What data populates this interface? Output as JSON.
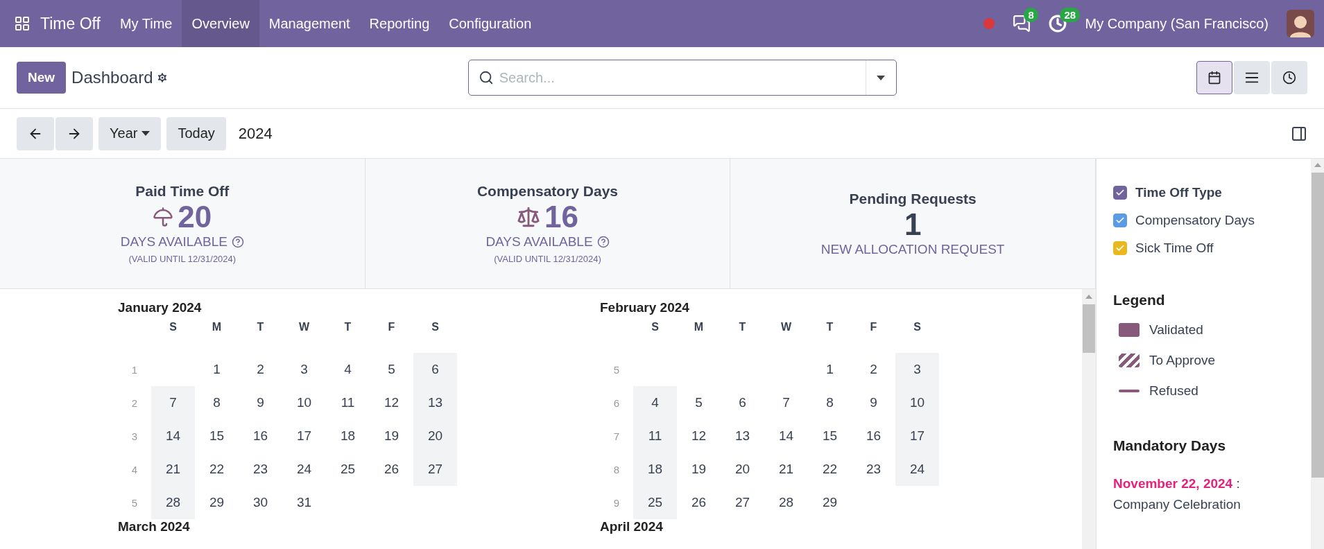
{
  "navbar": {
    "app_name": "Time Off",
    "menu": [
      {
        "label": "My Time",
        "selected": false
      },
      {
        "label": "Overview",
        "selected": true
      },
      {
        "label": "Management",
        "selected": false
      },
      {
        "label": "Reporting",
        "selected": false
      },
      {
        "label": "Configuration",
        "selected": false
      }
    ],
    "messages_count": "8",
    "activities_count": "28",
    "company": "My Company (San Francisco)"
  },
  "control_panel": {
    "new_button": "New",
    "breadcrumb": "Dashboard",
    "search": {
      "placeholder": "Search..."
    },
    "views": [
      {
        "kind": "calendar",
        "selected": true
      },
      {
        "kind": "list",
        "selected": false
      },
      {
        "kind": "activity",
        "selected": false
      }
    ]
  },
  "date_nav": {
    "scale": "Year",
    "today": "Today",
    "period": "2024"
  },
  "summary": [
    {
      "kind": "allocation",
      "title": "Paid Time Off",
      "count": "20",
      "label": "DAYS AVAILABLE",
      "validity": "(VALID UNTIL 12/31/2024)"
    },
    {
      "kind": "allocation",
      "title": "Compensatory Days",
      "count": "16",
      "label": "DAYS AVAILABLE",
      "validity": "(VALID UNTIL 12/31/2024)"
    },
    {
      "kind": "pending",
      "title": "Pending Requests",
      "count": "1",
      "label": "NEW ALLOCATION REQUEST"
    }
  ],
  "months": [
    {
      "title": "January 2024",
      "weekdays": [
        "S",
        "M",
        "T",
        "W",
        "T",
        "F",
        "S"
      ],
      "weeks": [
        {
          "number": "1",
          "mon": "1",
          "tue": "2",
          "wed": "3",
          "thu": "4",
          "fri": "5",
          "sat": "6"
        },
        {
          "number": "2",
          "sun": "7",
          "mon": "8",
          "tue": "9",
          "wed": "10",
          "thu": "11",
          "fri": "12",
          "sat": "13"
        },
        {
          "number": "3",
          "sun": "14",
          "mon": "15",
          "tue": "16",
          "wed": "17",
          "thu": "18",
          "fri": "19",
          "sat": "20"
        },
        {
          "number": "4",
          "sun": "21",
          "mon": "22",
          "tue": "23",
          "wed": "24",
          "thu": "25",
          "fri": "26",
          "sat": "27"
        },
        {
          "number": "5",
          "sun": "28",
          "mon": "29",
          "tue": "30",
          "wed": "31"
        }
      ]
    },
    {
      "title": "February 2024",
      "weekdays": [
        "S",
        "M",
        "T",
        "W",
        "T",
        "F",
        "S"
      ],
      "weeks": [
        {
          "number": "5",
          "thu": "1",
          "fri": "2",
          "sat": "3"
        },
        {
          "number": "6",
          "sun": "4",
          "mon": "5",
          "tue": "6",
          "wed": "7",
          "thu": "8",
          "fri": "9",
          "sat": "10"
        },
        {
          "number": "7",
          "sun": "11",
          "mon": "12",
          "tue": "13",
          "wed": "14",
          "thu": "15",
          "fri": "16",
          "sat": "17"
        },
        {
          "number": "8",
          "sun": "18",
          "mon": "19",
          "tue": "20",
          "wed": "21",
          "thu": "22",
          "fri": "23",
          "sat": "24"
        },
        {
          "number": "9",
          "sun": "25",
          "mon": "26",
          "tue": "27",
          "wed": "28",
          "thu": "29"
        }
      ]
    },
    {
      "title": "March 2024"
    },
    {
      "title": "April 2024"
    }
  ],
  "filters": {
    "title": "Time Off Type",
    "checked": true,
    "color": "#71639e",
    "items": [
      {
        "label": "Compensatory Days",
        "checked": true,
        "color": "#5b9be6"
      },
      {
        "label": "Sick Time Off",
        "checked": true,
        "color": "#e9b81d"
      }
    ]
  },
  "legend": {
    "title": "Legend",
    "items": [
      {
        "kind": "validated",
        "label": "Validated"
      },
      {
        "kind": "to_approve",
        "label": "To Approve"
      },
      {
        "kind": "refused",
        "label": "Refused"
      }
    ]
  },
  "mandatory_days": {
    "title": "Mandatory Days",
    "items": [
      {
        "date": "November 22, 2024",
        "separator": ":",
        "name": "Company Celebration",
        "color": "#e6217c"
      }
    ]
  }
}
